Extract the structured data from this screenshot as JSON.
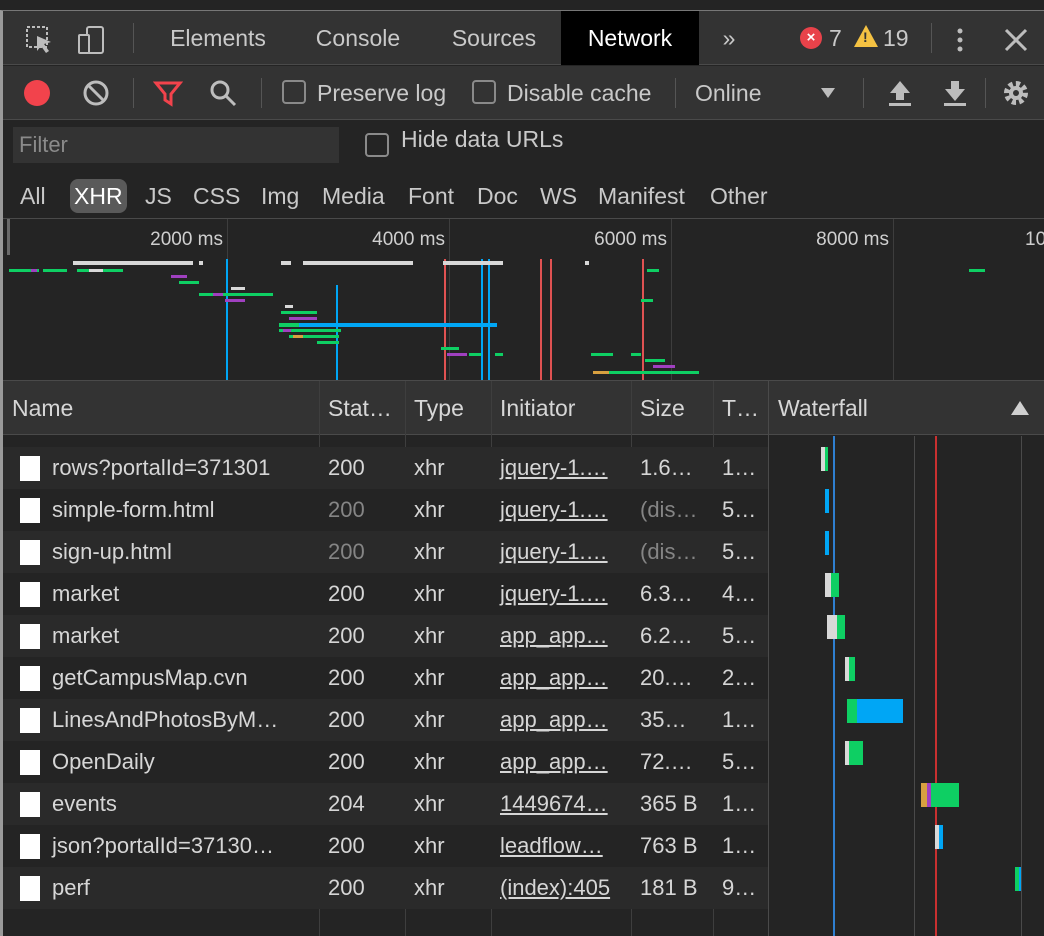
{
  "tabs": {
    "elements": "Elements",
    "console": "Console",
    "sources": "Sources",
    "network": "Network",
    "more": "»",
    "errors": "7",
    "warnings": "19"
  },
  "toolbar": {
    "preserve_log": "Preserve log",
    "disable_cache": "Disable cache",
    "throttle": "Online"
  },
  "filter": {
    "placeholder": "Filter",
    "hide_data_urls": "Hide data URLs",
    "types": [
      "All",
      "XHR",
      "JS",
      "CSS",
      "Img",
      "Media",
      "Font",
      "Doc",
      "WS",
      "Manifest",
      "Other"
    ],
    "active_type": "XHR"
  },
  "overview": {
    "ticks": [
      "2000 ms",
      "4000 ms",
      "6000 ms",
      "8000 ms",
      "10"
    ]
  },
  "table": {
    "headers": {
      "name": "Name",
      "status": "Stat…",
      "type": "Type",
      "initiator": "Initiator",
      "size": "Size",
      "time": "T…",
      "waterfall": "Waterfall"
    },
    "rows": [
      {
        "name": "rows?portalId=371301",
        "status": "200",
        "type": "xhr",
        "initiator": "jquery-1.…",
        "size": "1.6…",
        "time": "1…",
        "status_dim": false,
        "size_dim": false
      },
      {
        "name": "simple-form.html",
        "status": "200",
        "type": "xhr",
        "initiator": "jquery-1.…",
        "size": "(dis…",
        "time": "5…",
        "status_dim": true,
        "size_dim": true
      },
      {
        "name": "sign-up.html",
        "status": "200",
        "type": "xhr",
        "initiator": "jquery-1.…",
        "size": "(dis…",
        "time": "5…",
        "status_dim": true,
        "size_dim": true
      },
      {
        "name": "market",
        "status": "200",
        "type": "xhr",
        "initiator": "jquery-1.…",
        "size": "6.3…",
        "time": "4…",
        "status_dim": false,
        "size_dim": false
      },
      {
        "name": "market",
        "status": "200",
        "type": "xhr",
        "initiator": "app_app…",
        "size": "6.2…",
        "time": "5…",
        "status_dim": false,
        "size_dim": false
      },
      {
        "name": "getCampusMap.cvn",
        "status": "200",
        "type": "xhr",
        "initiator": "app_app…",
        "size": "20.…",
        "time": "2…",
        "status_dim": false,
        "size_dim": false
      },
      {
        "name": "LinesAndPhotosByM…",
        "status": "200",
        "type": "xhr",
        "initiator": "app_app…",
        "size": "35…",
        "time": "1…",
        "status_dim": false,
        "size_dim": false
      },
      {
        "name": "OpenDaily",
        "status": "200",
        "type": "xhr",
        "initiator": "app_app…",
        "size": "72.…",
        "time": "5…",
        "status_dim": false,
        "size_dim": false
      },
      {
        "name": "events",
        "status": "204",
        "type": "xhr",
        "initiator": "1449674…",
        "size": "365 B",
        "time": "1…",
        "status_dim": false,
        "size_dim": false
      },
      {
        "name": "json?portalId=37130…",
        "status": "200",
        "type": "xhr",
        "initiator": "leadflow…",
        "size": "763 B",
        "time": "1…",
        "status_dim": false,
        "size_dim": false
      },
      {
        "name": "perf",
        "status": "200",
        "type": "xhr",
        "initiator": "(index):405",
        "size": "181 B",
        "time": "9…",
        "status_dim": false,
        "size_dim": false
      }
    ]
  },
  "colors": {
    "accent_blue": "#00a6f5",
    "green": "#0ecf63",
    "red_line": "#e05252",
    "record_red": "#f2434c"
  }
}
